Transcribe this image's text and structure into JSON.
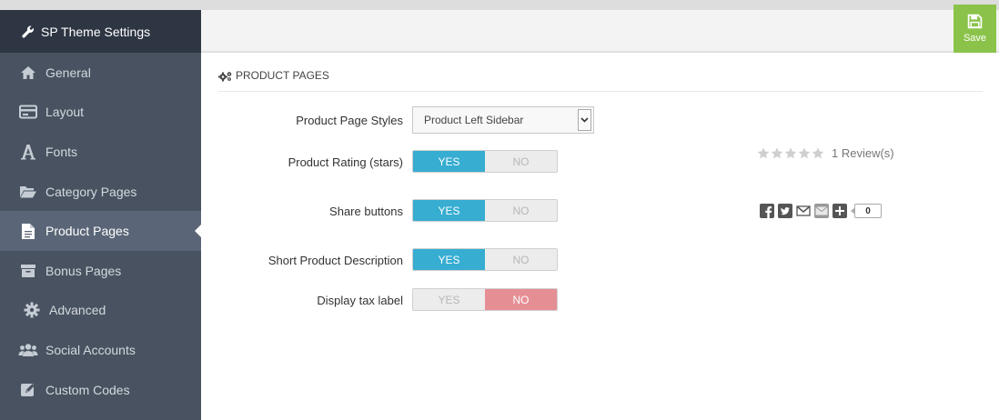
{
  "sidebar": {
    "title": "SP Theme Settings",
    "title_icon": "wrench-icon",
    "items": [
      {
        "label": "General",
        "icon": "home-icon"
      },
      {
        "label": "Layout",
        "icon": "credit-card-icon"
      },
      {
        "label": "Fonts",
        "icon": "font-icon"
      },
      {
        "label": "Category Pages",
        "icon": "folder-open-icon"
      },
      {
        "label": "Product Pages",
        "icon": "file-icon",
        "active": true
      },
      {
        "label": "Bonus Pages",
        "icon": "archive-icon"
      },
      {
        "label": "Advanced",
        "icon": "gear-icon"
      },
      {
        "label": "Social Accounts",
        "icon": "users-icon"
      },
      {
        "label": "Custom Codes",
        "icon": "edit-icon"
      }
    ]
  },
  "toolbar": {
    "save_label": "Save",
    "save_icon": "floppy-icon",
    "save_color": "#8bc34a"
  },
  "section": {
    "title": "PRODUCT PAGES",
    "icon": "gears-icon"
  },
  "form": {
    "product_page_styles": {
      "label": "Product Page Styles",
      "value": "Product Left Sidebar"
    },
    "product_rating": {
      "label": "Product Rating (stars)",
      "yes": "YES",
      "no": "NO",
      "selected": "YES"
    },
    "share_buttons": {
      "label": "Share buttons",
      "yes": "YES",
      "no": "NO",
      "selected": "YES"
    },
    "short_description": {
      "label": "Short Product Description",
      "yes": "YES",
      "no": "NO",
      "selected": "YES"
    },
    "display_tax_label": {
      "label": "Display tax label",
      "yes": "YES",
      "no": "NO",
      "selected": "NO"
    }
  },
  "preview": {
    "rating_stars": 0,
    "rating_max": 5,
    "reviews_text": "1 Review(s)",
    "share_icons": [
      "facebook-icon",
      "twitter-icon",
      "gmail-icon",
      "mail-icon",
      "plus-icon"
    ],
    "share_count": "0"
  },
  "colors": {
    "sidebar_bg": "#485260",
    "sidebar_header_bg": "#2e3643",
    "active_item_bg": "#5a6677",
    "toggle_yes": "#36add1",
    "toggle_no": "#e58f95"
  }
}
